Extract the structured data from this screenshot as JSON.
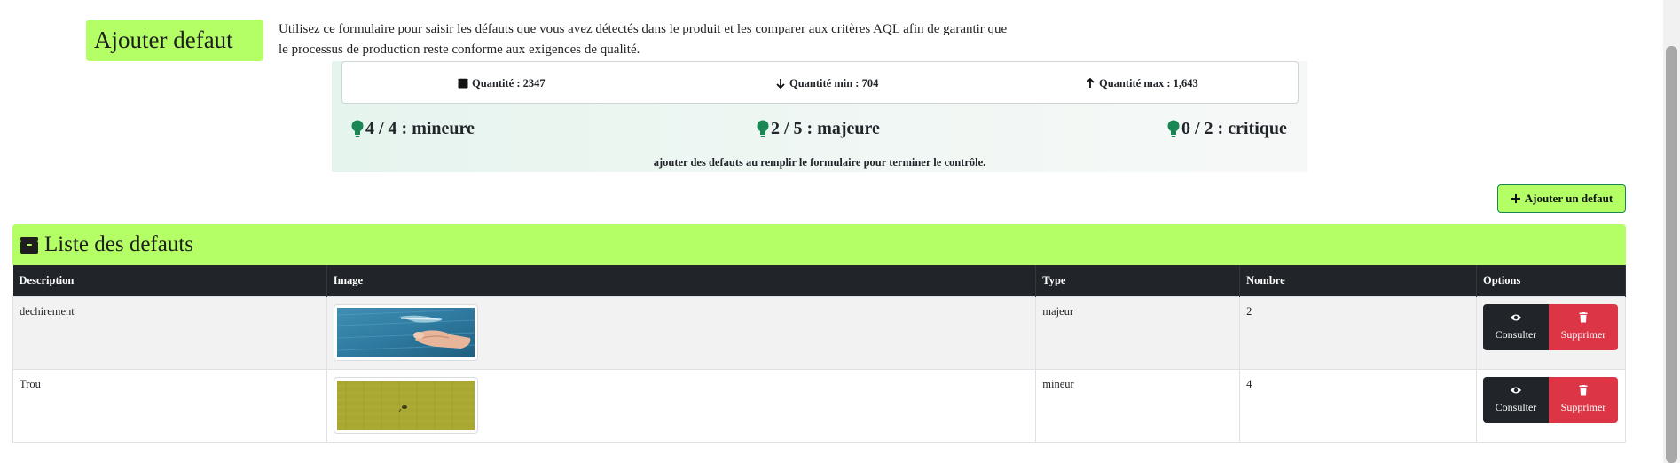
{
  "header": {
    "title": "Ajouter defaut",
    "intro_line1": "Utilisez ce formulaire pour saisir les défauts que vous avez détectés dans le produit et les comparer aux critères AQL afin de garantir que",
    "intro_line2": "le processus de production reste conforme aux exigences de qualité."
  },
  "quantities": {
    "total": "Quantité : 2347",
    "min": "Quantité min : 704",
    "max": "Quantité max : 1,643"
  },
  "severity": {
    "minor": "4 / 4 : mineure",
    "major": "2 / 5 : majeure",
    "critical": "0 / 2 : critique",
    "icon": "lightbulb-icon",
    "icon_color": "#198754"
  },
  "hint": "ajouter des defauts au remplir le formulaire pour terminer le contrôle.",
  "add_button": {
    "label": "Ajouter un defaut",
    "icon": "plus-icon"
  },
  "list": {
    "title": "Liste des defauts",
    "icon": "box-icon",
    "columns": [
      "Description",
      "Image",
      "Type",
      "Nombre",
      "Options"
    ],
    "rows": [
      {
        "description": "dechirement",
        "image": "torn-denim-photo",
        "type": "majeur",
        "count": "2",
        "view_label": "Consulter",
        "delete_label": "Supprimer"
      },
      {
        "description": "Trou",
        "image": "hole-fabric-photo",
        "type": "mineur",
        "count": "4",
        "view_label": "Consulter",
        "delete_label": "Supprimer"
      }
    ]
  },
  "colors": {
    "accent": "#b5ff66",
    "table_header": "#212529",
    "danger": "#dc3545",
    "success": "#198754"
  }
}
